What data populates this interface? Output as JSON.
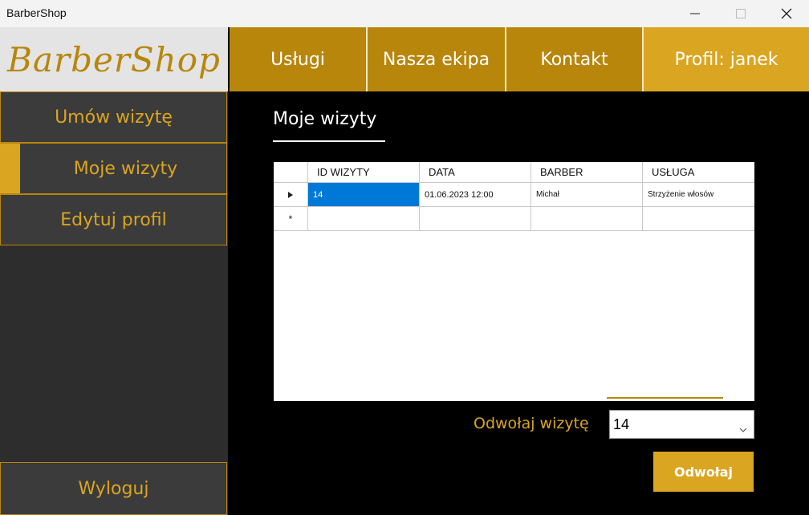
{
  "window": {
    "title": "BarberShop"
  },
  "logo": {
    "text": "BarberShop"
  },
  "nav": {
    "uslugi": "Usługi",
    "ekipa": "Nasza ekipa",
    "kontakt": "Kontakt",
    "profil": "Profil: janek"
  },
  "sidebar": {
    "umow": "Umów wizytę",
    "moje": "Moje wizyty",
    "edytuj": "Edytuj profil",
    "wyloguj": "Wyloguj"
  },
  "content": {
    "title": "Moje wizyty"
  },
  "grid": {
    "columns": [
      "ID WIZYTY",
      "DATA",
      "BARBER",
      "USŁUGA"
    ],
    "rows": [
      {
        "id": "14",
        "data": "01.06.2023 12:00",
        "barber": "Michał",
        "usluga": "Strzyżenie włosów"
      }
    ],
    "new_row_marker": "*"
  },
  "cancel": {
    "label": "Odwołaj wizytę",
    "selected": "14",
    "button": "Odwołaj"
  },
  "colors": {
    "gold": "#b8860b",
    "gold_light": "#daa520",
    "sidebar": "#2d2d2d",
    "selection": "#0078d7"
  }
}
